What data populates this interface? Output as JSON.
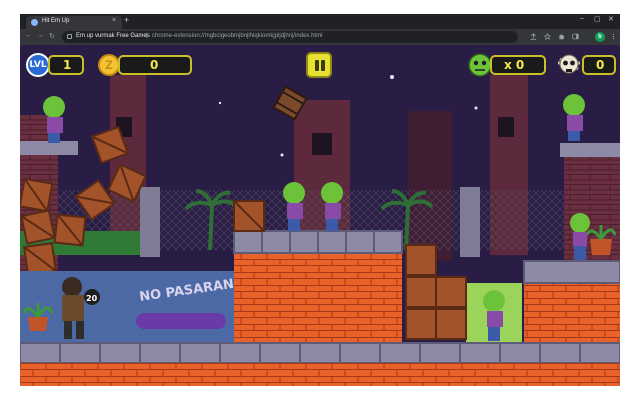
{
  "browser": {
    "tab_title": "Hit Em Up",
    "tab_close": "×",
    "new_tab": "+",
    "window_controls": [
      "–",
      "▢",
      "✕"
    ],
    "nav": {
      "back": "←",
      "forward": "→",
      "reload": "↻"
    },
    "site_name": "Em up vurmak Free Games",
    "separator": "|",
    "url": "chrome-extension://mgbcigeobmjbnjlhiqkiomkjpljdjhnj/index.html",
    "profile_initial": "b"
  },
  "hud": {
    "level_badge": "LVL",
    "level_value": "1",
    "coin_symbol": "Z",
    "coins_value": "0",
    "kills_value": "x 0",
    "skulls_value": "0"
  },
  "scene": {
    "graffiti_text": "NO PASARAN",
    "player_counter": "20"
  },
  "colors": {
    "sky": "#2a1d45",
    "brick_orange": "#e8622a",
    "stone_top": "#8d8aa6",
    "zombie_green": "#6cc33a",
    "hud_yellow": "#f2e94e"
  }
}
